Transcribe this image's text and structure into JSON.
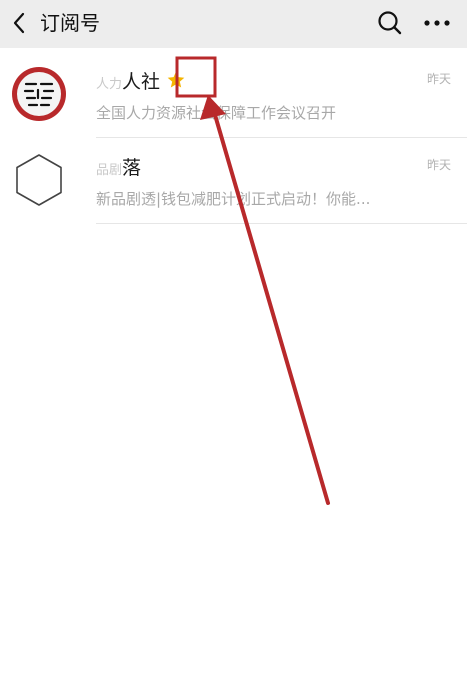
{
  "header": {
    "title": "订阅号",
    "back_icon": "chevron-left-icon",
    "search_icon": "search-icon",
    "more_icon": "more-horizontal-icon"
  },
  "subscriptions": [
    {
      "name_prefix": "人力",
      "name": "人社",
      "badge_icon": "star-icon",
      "badge_color": "#f5b400",
      "time": "昨天",
      "preview": "全国人力资源社会保障工作会议召开"
    },
    {
      "name_prefix": "品剧",
      "name": "落",
      "time": "昨天",
      "preview": "新品剧透|钱包减肥计划正式启动！你能..."
    }
  ],
  "colors": {
    "header_bg": "#ededed",
    "highlight": "#b8292b"
  }
}
